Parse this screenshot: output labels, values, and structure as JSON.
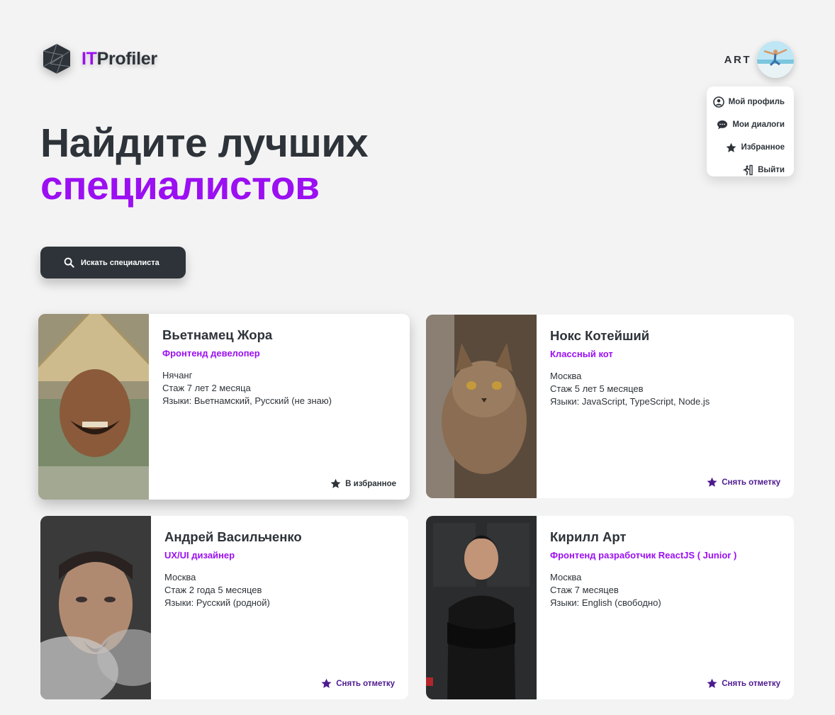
{
  "header": {
    "logo": {
      "brand_accent": "IT",
      "brand_rest": "Profiler"
    },
    "user": {
      "name": "ART"
    }
  },
  "user_menu": {
    "items": [
      {
        "label": "Мой профиль",
        "icon": "user-circle-icon"
      },
      {
        "label": "Мои диалоги",
        "icon": "chat-bubble-icon"
      },
      {
        "label": "Избранное",
        "icon": "star-icon"
      },
      {
        "label": "Выйти",
        "icon": "exit-icon"
      }
    ]
  },
  "hero": {
    "line1": "Найдите лучших",
    "line2": "специалистов"
  },
  "search": {
    "label": "Искать специалиста"
  },
  "cards": [
    {
      "name": "Вьетнамец Жора",
      "role": "Фронтенд девелопер",
      "city": "Нячанг",
      "experience": "Стаж 7 лет 2 месяца",
      "languages": "Языки: Вьетнамский, Русский (не знаю)",
      "fav_label": "В избранное",
      "favorited": false
    },
    {
      "name": "Нокс Котейший",
      "role": "Классный кот",
      "city": "Москва",
      "experience": "Стаж 5 лет 5 месяцев",
      "languages": "Языки: JavaScript, TypeScript, Node.js",
      "fav_label": "Снять отметку",
      "favorited": true
    },
    {
      "name": "Андрей Васильченко",
      "role": "UX/UI дизайнер",
      "city": "Москва",
      "experience": "Стаж 2 года 5 месяцев",
      "languages": "Языки: Русский (родной)",
      "fav_label": "Снять отметку",
      "favorited": true
    },
    {
      "name": "Кирилл Арт",
      "role": "Фронтенд разработчик ReactJS ( Junior )",
      "city": "Москва",
      "experience": "Стаж 7 месяцев",
      "languages": "Языки: English (свободно)",
      "fav_label": "Снять отметку",
      "favorited": true
    }
  ],
  "colors": {
    "accent": "#9b0ff2",
    "dark": "#2d3339",
    "favorite": "#4e1a8f",
    "background": "#f3f3f3"
  }
}
